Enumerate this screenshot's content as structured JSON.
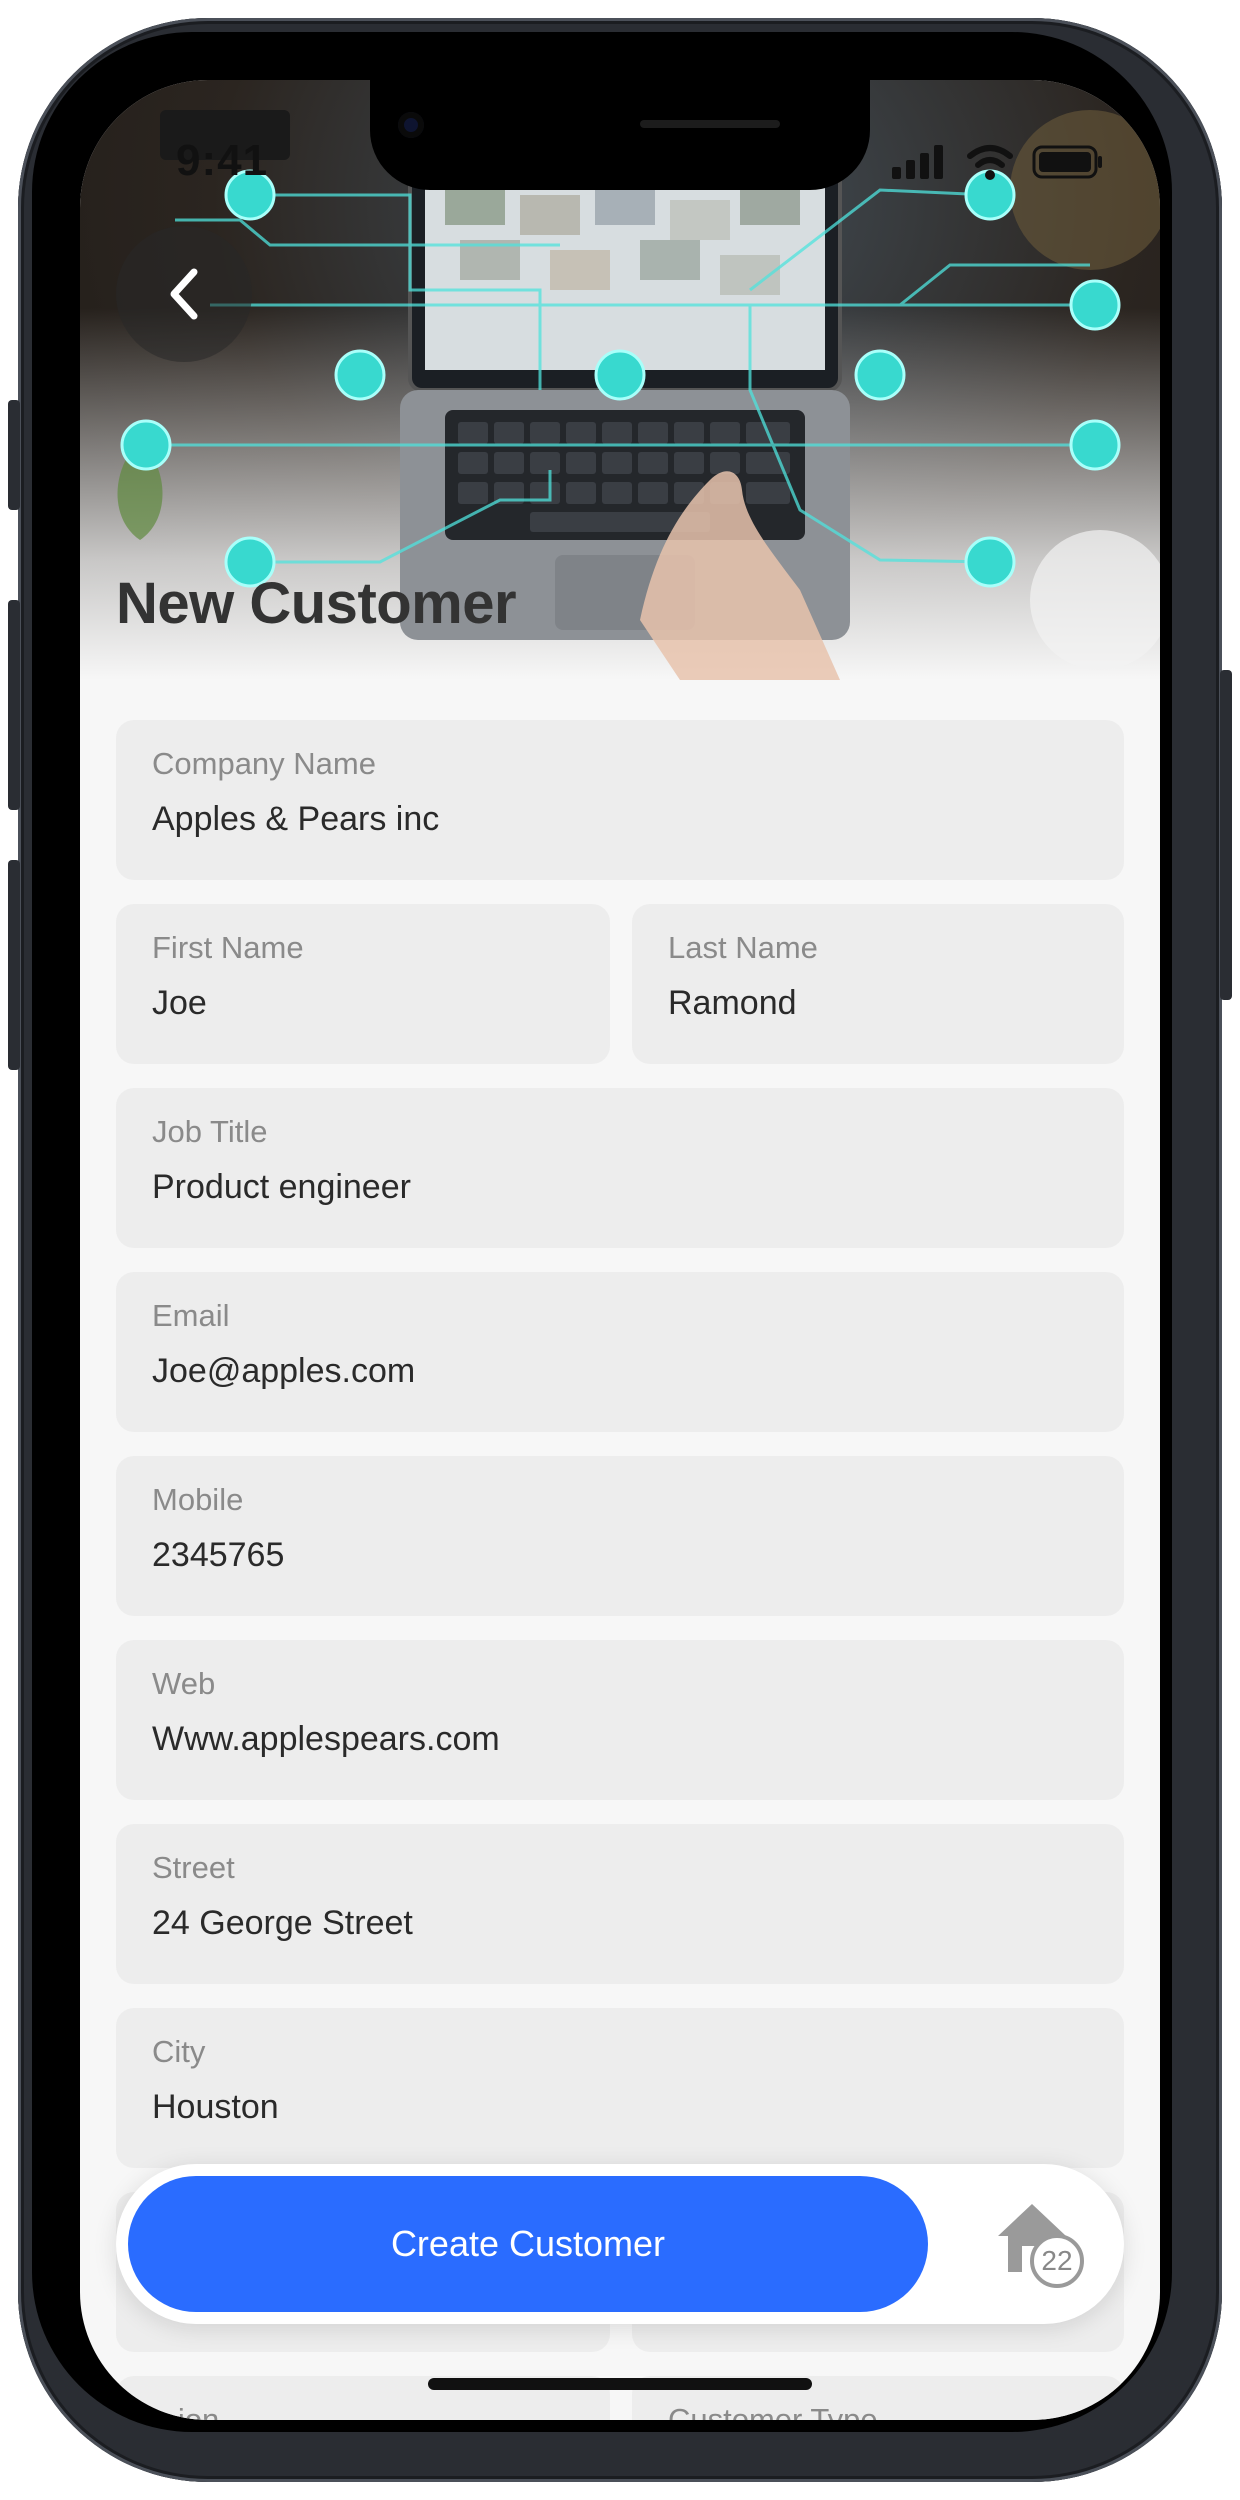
{
  "status_bar": {
    "time": "9:41"
  },
  "page": {
    "title": "New Customer"
  },
  "form": {
    "company_name": {
      "label": "Company Name",
      "value": "Apples & Pears inc"
    },
    "first_name": {
      "label": "First Name",
      "value": "Joe"
    },
    "last_name": {
      "label": "Last Name",
      "value": "Ramond"
    },
    "job_title": {
      "label": "Job Title",
      "value": "Product engineer"
    },
    "email": {
      "label": "Email",
      "value": "Joe@apples.com"
    },
    "mobile": {
      "label": "Mobile",
      "value": "2345765"
    },
    "web": {
      "label": "Web",
      "value": "Www.applespears.com"
    },
    "street": {
      "label": "Street",
      "value": "24 George Street"
    },
    "city": {
      "label": "City",
      "value": "Houston"
    },
    "region_partial": {
      "label": "...ion"
    },
    "customer_type_partial": {
      "label": "Customer Type"
    }
  },
  "actions": {
    "create_label": "Create Customer",
    "home_badge": "22"
  },
  "colors": {
    "accent": "#2a6cff",
    "field_bg": "#ededed",
    "screen_bg": "#f7f7f7",
    "network_cyan": "#4fe3dd"
  },
  "icons": [
    "back-chevron-icon",
    "signal-icon",
    "wifi-icon",
    "battery-icon",
    "home-icon"
  ]
}
